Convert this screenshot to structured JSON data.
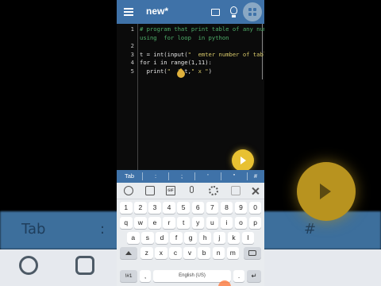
{
  "app": {
    "title": "new*",
    "accent_color": "#3f72a8",
    "fab_color": "#e8c132"
  },
  "editor": {
    "lines": [
      {
        "num": "1",
        "parts": [
          {
            "t": "# program that print table of any number",
            "c": "comment"
          }
        ]
      },
      {
        "num": "",
        "parts": [
          {
            "t": "using  for loop  in python",
            "c": "comment"
          }
        ]
      },
      {
        "num": "2",
        "parts": []
      },
      {
        "num": "3",
        "parts": [
          {
            "t": "t = int(input(",
            "c": "code"
          },
          {
            "t": "\"  emter number of table :\"",
            "c": "str"
          },
          {
            "t": "))",
            "c": "code"
          }
        ]
      },
      {
        "num": "4",
        "parts": [
          {
            "t": "for i in range(1,11):",
            "c": "code"
          }
        ]
      },
      {
        "num": "5",
        "parts": [
          {
            "t": "  print(",
            "c": "code"
          },
          {
            "t": "\"  \"",
            "c": "str"
          },
          {
            "t": ",t,",
            "c": "code"
          },
          {
            "t": "\" x \"",
            "c": "str"
          },
          {
            "t": ")",
            "c": "code"
          }
        ]
      }
    ]
  },
  "symbol_bar": [
    "Tab",
    ":",
    ";",
    "'",
    "\"",
    "#"
  ],
  "keyboard": {
    "tools": [
      "emoji-icon",
      "sticker-icon",
      "gif-icon",
      "mic-icon",
      "gear-icon",
      "clipboard-icon",
      "close-icon"
    ],
    "gif_label": "GIF",
    "row_numbers": [
      "1",
      "2",
      "3",
      "4",
      "5",
      "6",
      "7",
      "8",
      "9",
      "0"
    ],
    "row_q": [
      "q",
      "w",
      "e",
      "r",
      "t",
      "y",
      "u",
      "i",
      "o",
      "p"
    ],
    "row_a": [
      "a",
      "s",
      "d",
      "f",
      "g",
      "h",
      "j",
      "k",
      "l"
    ],
    "row_z": [
      "z",
      "x",
      "c",
      "v",
      "b",
      "n",
      "m"
    ],
    "sym_key": "!#1",
    "comma_key": ",",
    "space_label": "English (US)",
    "period_key": ".",
    "enter_symbol": "↵"
  }
}
